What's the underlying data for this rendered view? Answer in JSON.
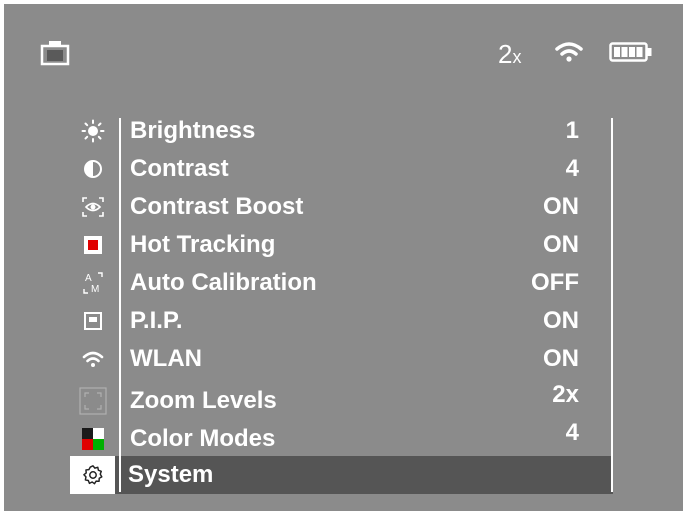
{
  "status_bar": {
    "zoom_value": "2",
    "zoom_unit": "x"
  },
  "menu": {
    "items": [
      {
        "label": "Brightness",
        "value": "1",
        "icon": "brightness-icon"
      },
      {
        "label": "Contrast",
        "value": "4",
        "icon": "contrast-icon"
      },
      {
        "label": "Contrast Boost",
        "value": "ON",
        "icon": "contrast-boost-icon"
      },
      {
        "label": "Hot Tracking",
        "value": "ON",
        "icon": "hot-tracking-icon"
      },
      {
        "label": "Auto Calibration",
        "value": "OFF",
        "icon": "auto-calibration-icon"
      },
      {
        "label": "P.I.P.",
        "value": "ON",
        "icon": "pip-icon"
      },
      {
        "label": "WLAN",
        "value": "ON",
        "icon": "wlan-icon"
      },
      {
        "label": "Zoom Levels",
        "value": "2x",
        "icon": "zoom-levels-icon"
      },
      {
        "label": "Color Modes",
        "value": "4",
        "icon": "color-modes-icon"
      },
      {
        "label": "System",
        "value": "",
        "icon": "gear-icon"
      }
    ],
    "selected_index": 9,
    "auto_calibration_icon_text": {
      "a": "A",
      "m": "M"
    }
  },
  "colors": {
    "background": "#8b8b8b",
    "text": "#ffffff",
    "selected_bar": "#555555",
    "hot_tracking_red": "#e00000",
    "color_mode_red": "#e00000",
    "color_mode_green": "#00b000"
  }
}
